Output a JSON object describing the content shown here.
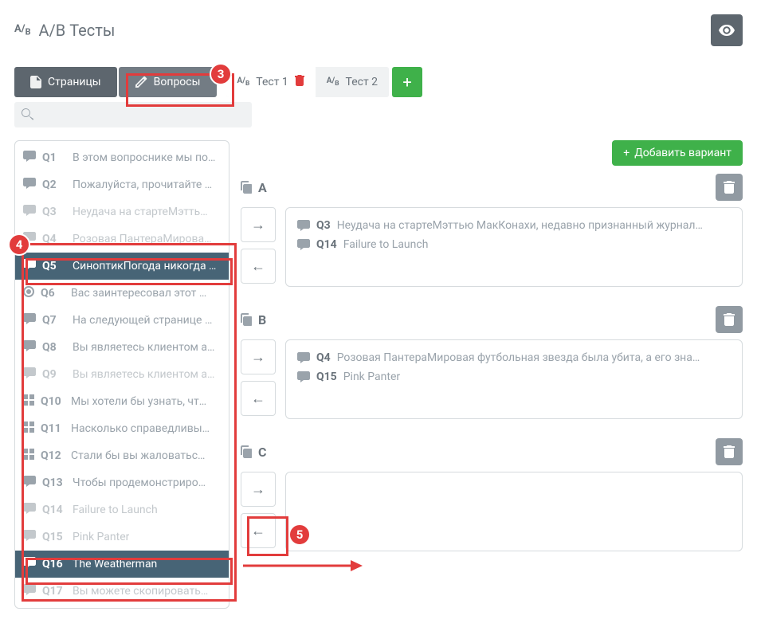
{
  "header": {
    "title": "A/B Тесты"
  },
  "tabs": {
    "pages": "Страницы",
    "questions": "Вопросы"
  },
  "tests": [
    {
      "label": "Тест 1",
      "active": true,
      "deletable": true
    },
    {
      "label": "Тест 2",
      "active": false,
      "deletable": false
    }
  ],
  "add_variant_label": "Добавить вариант",
  "search": {
    "placeholder": ""
  },
  "questions": [
    {
      "num": "Q1",
      "text": "В этом вопроснике мы по…",
      "icon": "chat",
      "state": "normal"
    },
    {
      "num": "Q2",
      "text": "Пожалуйста, прочитайте …",
      "icon": "chat",
      "state": "normal"
    },
    {
      "num": "Q3",
      "text": "Неудача на стартеМэтть…",
      "icon": "chat",
      "state": "dim"
    },
    {
      "num": "Q4",
      "text": "Розовая ПантераМирова…",
      "icon": "chat",
      "state": "dim"
    },
    {
      "num": "Q5",
      "text": "СиноптикПогода никогда …",
      "icon": "chat",
      "state": "selected"
    },
    {
      "num": "Q6",
      "text": "Вас заинтересовал этот …",
      "icon": "radio",
      "state": "normal"
    },
    {
      "num": "Q7",
      "text": "На следующей странице …",
      "icon": "chat",
      "state": "normal"
    },
    {
      "num": "Q8",
      "text": "Вы являетесь клиентом а…",
      "icon": "chat",
      "state": "normal"
    },
    {
      "num": "Q9",
      "text": "Вы являетесь клиентом а…",
      "icon": "chat",
      "state": "dim"
    },
    {
      "num": "Q10",
      "text": "Мы хотели бы узнать, чт…",
      "icon": "grid",
      "state": "normal"
    },
    {
      "num": "Q11",
      "text": "Насколько справедливы…",
      "icon": "grid",
      "state": "normal"
    },
    {
      "num": "Q12",
      "text": "Стали бы вы жаловатьс…",
      "icon": "grid",
      "state": "normal"
    },
    {
      "num": "Q13",
      "text": "Чтобы продемонстриро…",
      "icon": "chat",
      "state": "normal"
    },
    {
      "num": "Q14",
      "text": "Failure to Launch",
      "icon": "chat",
      "state": "dim"
    },
    {
      "num": "Q15",
      "text": "Pink Panter",
      "icon": "chat",
      "state": "dim"
    },
    {
      "num": "Q16",
      "text": "The Weatherman",
      "icon": "chat",
      "state": "selected"
    },
    {
      "num": "Q17",
      "text": "Вы можете скопировать…",
      "icon": "chat",
      "state": "dim"
    }
  ],
  "variants": [
    {
      "label": "A",
      "items": [
        {
          "num": "Q3",
          "text": "Неудача на стартеМэттью МакКонахи, недавно признанный журнал…"
        },
        {
          "num": "Q14",
          "text": "Failure to Launch"
        }
      ]
    },
    {
      "label": "B",
      "items": [
        {
          "num": "Q4",
          "text": "Розовая ПантераМировая футбольная звезда была убита, а его зна…"
        },
        {
          "num": "Q15",
          "text": "Pink Panter"
        }
      ]
    },
    {
      "label": "C",
      "items": []
    }
  ],
  "annotations": {
    "3": "3",
    "4": "4",
    "5": "5"
  }
}
